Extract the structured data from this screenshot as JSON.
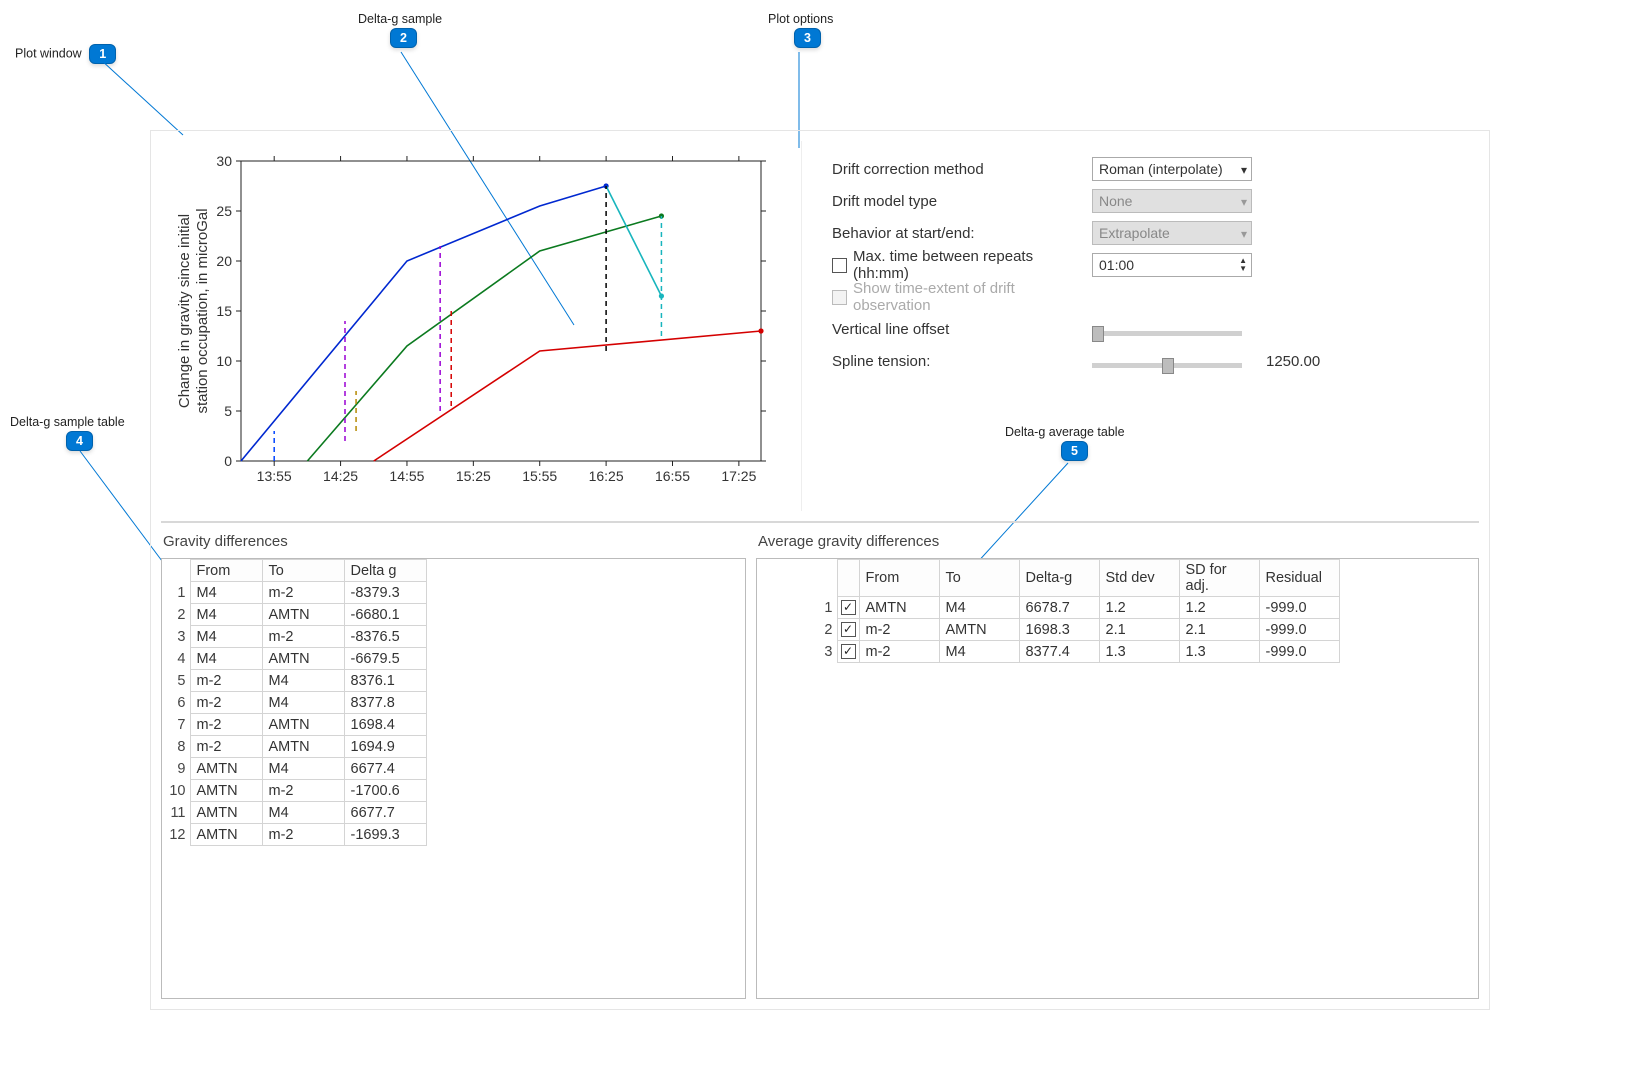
{
  "callouts": {
    "plot_window": "Plot window",
    "delta_g_sample": "Delta-g sample",
    "plot_options": "Plot options",
    "delta_g_sample_table": "Delta-g sample table",
    "delta_g_average_table": "Delta-g average table"
  },
  "options": {
    "drift_method_label": "Drift correction method",
    "drift_method_value": "Roman (interpolate)",
    "drift_model_label": "Drift model type",
    "drift_model_value": "None",
    "behavior_label": "Behavior at start/end:",
    "behavior_value": "Extrapolate",
    "max_time_label": "Max. time between repeats (hh:mm)",
    "max_time_value": "01:00",
    "show_extent_label": "Show time-extent of drift observation",
    "v_offset_label": "Vertical line offset",
    "spline_label": "Spline tension:",
    "spline_value": "1250.00"
  },
  "tables": {
    "left_title": "Gravity differences",
    "left_headers": [
      "From",
      "To",
      "Delta g"
    ],
    "left_rows": [
      [
        "M4",
        "m-2",
        "-8379.3"
      ],
      [
        "M4",
        "AMTN",
        "-6680.1"
      ],
      [
        "M4",
        "m-2",
        "-8376.5"
      ],
      [
        "M4",
        "AMTN",
        "-6679.5"
      ],
      [
        "m-2",
        "M4",
        "8376.1"
      ],
      [
        "m-2",
        "M4",
        "8377.8"
      ],
      [
        "m-2",
        "AMTN",
        "1698.4"
      ],
      [
        "m-2",
        "AMTN",
        "1694.9"
      ],
      [
        "AMTN",
        "M4",
        "6677.4"
      ],
      [
        "AMTN",
        "m-2",
        "-1700.6"
      ],
      [
        "AMTN",
        "M4",
        "6677.7"
      ],
      [
        "AMTN",
        "m-2",
        "-1699.3"
      ]
    ],
    "right_title": "Average gravity differences",
    "right_headers": [
      "From",
      "To",
      "Delta-g",
      "Std dev",
      "SD for adj.",
      "Residual"
    ],
    "right_rows": [
      {
        "checked": true,
        "cells": [
          "AMTN",
          "M4",
          "6678.7",
          "1.2",
          "1.2",
          "-999.0"
        ]
      },
      {
        "checked": true,
        "cells": [
          "m-2",
          "AMTN",
          "1698.3",
          "2.1",
          "2.1",
          "-999.0"
        ]
      },
      {
        "checked": true,
        "cells": [
          "m-2",
          "M4",
          "8377.4",
          "1.3",
          "1.3",
          "-999.0"
        ]
      }
    ]
  },
  "chart_data": {
    "type": "line",
    "ylabel_line1": "Change in gravity since initial",
    "ylabel_line2": "station occupation, in microGal",
    "y_ticks": [
      0,
      5,
      10,
      15,
      20,
      25,
      30
    ],
    "ylim": [
      0,
      30
    ],
    "x_ticks": [
      "13:55",
      "14:25",
      "14:55",
      "15:25",
      "15:55",
      "16:25",
      "16:55",
      "17:25"
    ],
    "series": [
      {
        "name": "blue",
        "color": "#0028d0",
        "x": [
          "13:40",
          "14:55",
          "15:55",
          "16:25"
        ],
        "y": [
          0,
          20,
          25.5,
          27.5
        ]
      },
      {
        "name": "green",
        "color": "#0b7a1f",
        "x": [
          "14:10",
          "14:55",
          "15:55",
          "16:50"
        ],
        "y": [
          0,
          11.5,
          21,
          24.5
        ]
      },
      {
        "name": "red",
        "color": "#d40000",
        "x": [
          "14:40",
          "15:55",
          "17:35"
        ],
        "y": [
          0,
          11,
          13
        ]
      },
      {
        "name": "cyan-short",
        "color": "#18b5bd",
        "x": [
          "16:25",
          "16:50"
        ],
        "y": [
          27.5,
          16.5
        ]
      }
    ],
    "verticals": [
      {
        "color": "#0044ff",
        "x": "13:55",
        "y0": 0,
        "y1": 3
      },
      {
        "color": "#9a00d4",
        "x": "14:27",
        "y0": 2,
        "y1": 14
      },
      {
        "color": "#b58900",
        "x": "14:32",
        "y0": 3,
        "y1": 7
      },
      {
        "color": "#9a00d4",
        "x": "15:10",
        "y0": 5,
        "y1": 21.5
      },
      {
        "color": "#d40000",
        "x": "15:15",
        "y0": 5.5,
        "y1": 15
      },
      {
        "color": "#000000",
        "x": "16:25",
        "y0": 11,
        "y1": 27.5
      },
      {
        "color": "#18b5bd",
        "x": "16:50",
        "y0": 12.5,
        "y1": 24.5
      }
    ]
  }
}
